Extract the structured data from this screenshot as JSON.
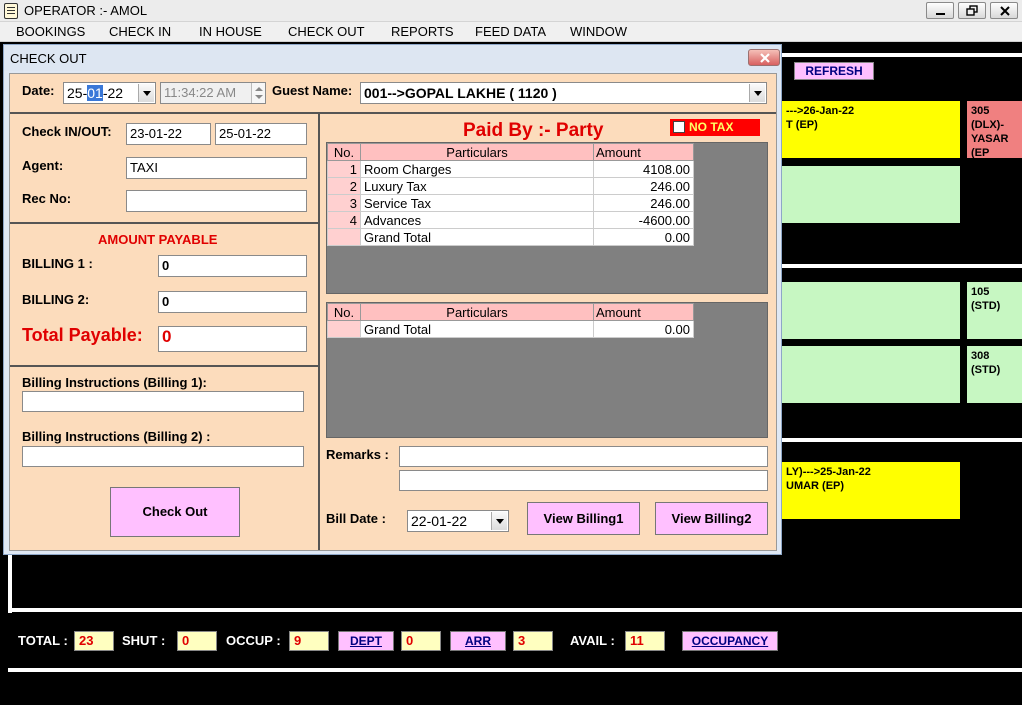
{
  "window": {
    "title": "OPERATOR :- AMOL"
  },
  "menu": [
    "BOOKINGS",
    "CHECK IN",
    "IN HOUSE",
    "CHECK OUT",
    "REPORTS",
    "FEED DATA",
    "WINDOW"
  ],
  "background": {
    "refresh_label": "REFRESH",
    "rooms": [
      {
        "line1": "--->26-Jan-22",
        "line2": "T (EP)",
        "status": "yellow"
      },
      {
        "line1": "305 (DLX)-",
        "line2": "YASAR (EP",
        "status": "red"
      },
      {
        "line1": "",
        "line2": "",
        "status": "green"
      },
      {
        "line1": "",
        "line2": "",
        "status": "green"
      },
      {
        "line1": "105 (STD)",
        "line2": "",
        "status": "green"
      },
      {
        "line1": "",
        "line2": "",
        "status": "green"
      },
      {
        "line1": "308 (STD)",
        "line2": "",
        "status": "green"
      },
      {
        "line1": "LY)--->25-Jan-22",
        "line2": "UMAR (EP)",
        "status": "yellow"
      }
    ]
  },
  "stats": {
    "total_label": "TOTAL :",
    "total": "23",
    "shut_label": "SHUT :",
    "shut": "0",
    "occup_label": "OCCUP :",
    "occup": "9",
    "dept_button": "DEPT",
    "dept": "0",
    "arr_button": "ARR",
    "arr": "3",
    "avail_label": "AVAIL :",
    "avail": "11",
    "occupancy_button": "OCCUPANCY"
  },
  "dialog": {
    "title": "CHECK OUT",
    "date_label": "Date:",
    "date_day": "25-",
    "date_month": "01",
    "date_year": "-22",
    "time": "11:34:22 AM",
    "guest_name_label": "Guest Name:",
    "guest_name": "001-->GOPAL LAKHE ( 1120 )",
    "checkinout_label": "Check IN/OUT:",
    "check_in": "23-01-22",
    "check_out": "25-01-22",
    "agent_label": "Agent:",
    "agent": "TAXI",
    "rec_no_label": "Rec No:",
    "rec_no": "",
    "amount_payable_title": "AMOUNT PAYABLE",
    "billing1_label": "BILLING 1 :",
    "billing1": "0",
    "billing2_label": "BILLING 2:",
    "billing2": "0",
    "total_payable_label": "Total Payable:",
    "total_payable": "0",
    "instr1_label": "Billing Instructions (Billing 1):",
    "instr1": "",
    "instr2_label": "Billing Instructions (Billing 2) :",
    "instr2": "",
    "checkout_button": "Check Out",
    "paid_by": "Paid By :- Party",
    "no_tax_label": "NO TAX",
    "no_tax_checked": false,
    "grid1": {
      "headers": [
        "No.",
        "Particulars",
        "Amount"
      ],
      "rows": [
        {
          "no": "1",
          "particular": "Room Charges",
          "amount": "4108.00"
        },
        {
          "no": "2",
          "particular": "Luxury Tax",
          "amount": "246.00"
        },
        {
          "no": "3",
          "particular": "Service Tax",
          "amount": "246.00"
        },
        {
          "no": "4",
          "particular": "Advances",
          "amount": "-4600.00"
        },
        {
          "no": "",
          "particular": "Grand Total",
          "amount": "0.00"
        }
      ]
    },
    "grid2": {
      "headers": [
        "No.",
        "Particulars",
        "Amount"
      ],
      "rows": [
        {
          "no": "",
          "particular": "Grand Total",
          "amount": "0.00"
        }
      ]
    },
    "remarks_label": "Remarks :",
    "remarks1": "",
    "remarks2": "",
    "bill_date_label": "Bill Date :",
    "bill_date": "22-01-22",
    "view_billing1": "View Billing1",
    "view_billing2": "View Billing2"
  }
}
